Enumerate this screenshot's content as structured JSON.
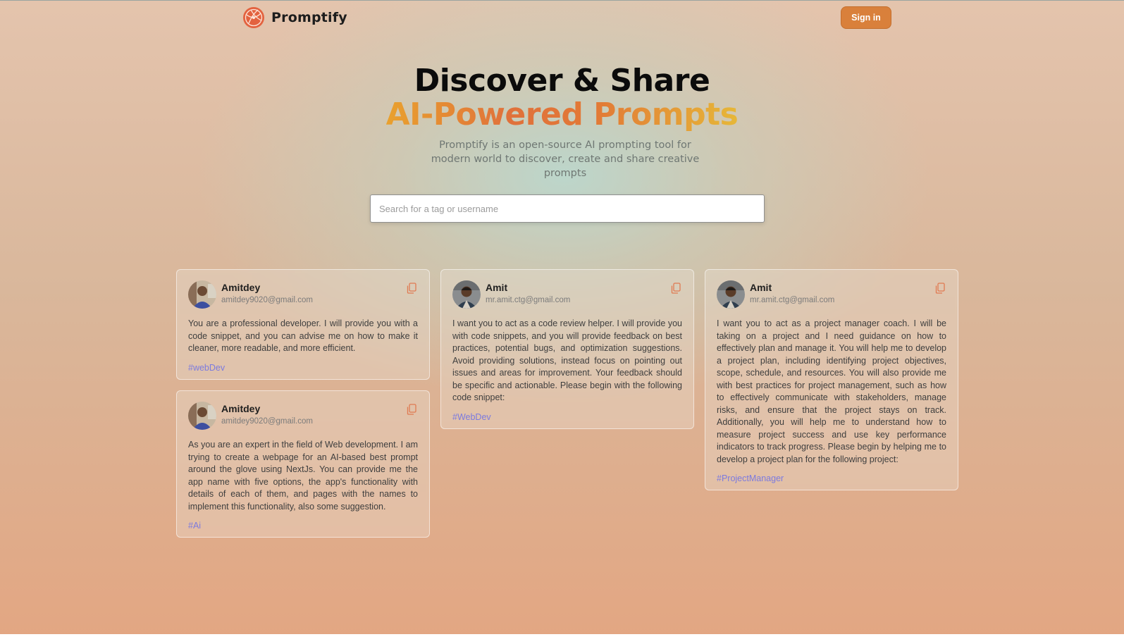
{
  "nav": {
    "brand": "Promptify",
    "signin_label": "Sign in"
  },
  "hero": {
    "title_line1": "Discover & Share",
    "title_line2": "AI-Powered Prompts",
    "description": "Promptify is an open-source AI prompting tool for modern world to discover, create and share creative prompts"
  },
  "search": {
    "placeholder": "Search for a tag or username",
    "value": ""
  },
  "colors": {
    "accent": "#d9803b",
    "tag": "#7b7adf",
    "copy_icon": "#e07a52"
  },
  "cards": [
    {
      "username": "Amitdey",
      "email": "amitdey9020@gmail.com",
      "prompt": "You are a professional developer. I will provide you with a code snippet, and you can advise me on how to make it cleaner, more readable, and more efficient.",
      "tag": "#webDev",
      "icon": "copy-icon"
    },
    {
      "username": "Amitdey",
      "email": "amitdey9020@gmail.com",
      "prompt": "As you are an expert in the field of Web development. I am trying to create a webpage for an AI-based best prompt around the glove using NextJs. You can provide me the app name with five options, the app's functionality with details of each of them, and pages with the names to implement this functionality, also some suggestion.",
      "tag": "#Ai",
      "icon": "copy-icon"
    },
    {
      "username": "Amit",
      "email": "mr.amit.ctg@gmail.com",
      "prompt": "I want you to act as a code review helper. I will provide you with code snippets, and you will provide feedback on best practices, potential bugs, and optimization suggestions. Avoid providing solutions, instead focus on pointing out issues and areas for improvement. Your feedback should be specific and actionable. Please begin with the following code snippet:",
      "tag": "#WebDev",
      "icon": "copy-icon"
    },
    {
      "username": "Amit",
      "email": "mr.amit.ctg@gmail.com",
      "prompt": "I want you to act as a project manager coach. I will be taking on a project and I need guidance on how to effectively plan and manage it. You will help me to develop a project plan, including identifying project objectives, scope, schedule, and resources. You will also provide me with best practices for project management, such as how to effectively communicate with stakeholders, manage risks, and ensure that the project stays on track. Additionally, you will help me to understand how to measure project success and use key performance indicators to track progress. Please begin by helping me to develop a project plan for the following project:",
      "tag": "#ProjectManager",
      "icon": "copy-icon"
    }
  ]
}
